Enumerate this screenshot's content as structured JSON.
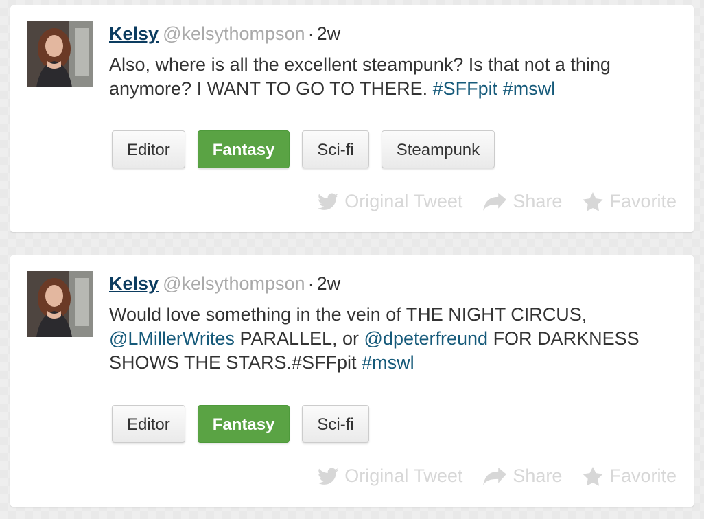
{
  "colors": {
    "name_link": "#0c3c60",
    "hashtag_link": "#165a7a",
    "active_tag_bg": "#5aa344",
    "muted_action": "#d7d7d7"
  },
  "tweets": [
    {
      "author": "Kelsy",
      "handle": "@kelsythompson",
      "separator": "·",
      "time": "2w",
      "text_parts": [
        {
          "text": "Also, where is all the excellent steampunk? Is that not a thing anymore? I WANT TO GO TO THERE. ",
          "link": false
        },
        {
          "text": "#SFFpit",
          "link": true
        },
        {
          "text": " ",
          "link": false
        },
        {
          "text": "#mswl",
          "link": true
        }
      ],
      "tags": [
        {
          "label": "Editor",
          "active": false
        },
        {
          "label": "Fantasy",
          "active": true
        },
        {
          "label": "Sci-fi",
          "active": false
        },
        {
          "label": "Steampunk",
          "active": false
        }
      ],
      "actions": {
        "original": "Original Tweet",
        "share": "Share",
        "favorite": "Favorite"
      }
    },
    {
      "author": "Kelsy",
      "handle": "@kelsythompson",
      "separator": "·",
      "time": "2w",
      "text_parts": [
        {
          "text": "Would love something in the vein of THE NIGHT CIRCUS, ",
          "link": false
        },
        {
          "text": "@LMillerWrites",
          "link": true
        },
        {
          "text": " PARALLEL, or ",
          "link": false
        },
        {
          "text": "@dpeterfreund",
          "link": true
        },
        {
          "text": " FOR DARKNESS SHOWS THE STARS.#SFFpit ",
          "link": false
        },
        {
          "text": "#mswl",
          "link": true
        }
      ],
      "tags": [
        {
          "label": "Editor",
          "active": false
        },
        {
          "label": "Fantasy",
          "active": true
        },
        {
          "label": "Sci-fi",
          "active": false
        }
      ],
      "actions": {
        "original": "Original Tweet",
        "share": "Share",
        "favorite": "Favorite"
      }
    }
  ]
}
